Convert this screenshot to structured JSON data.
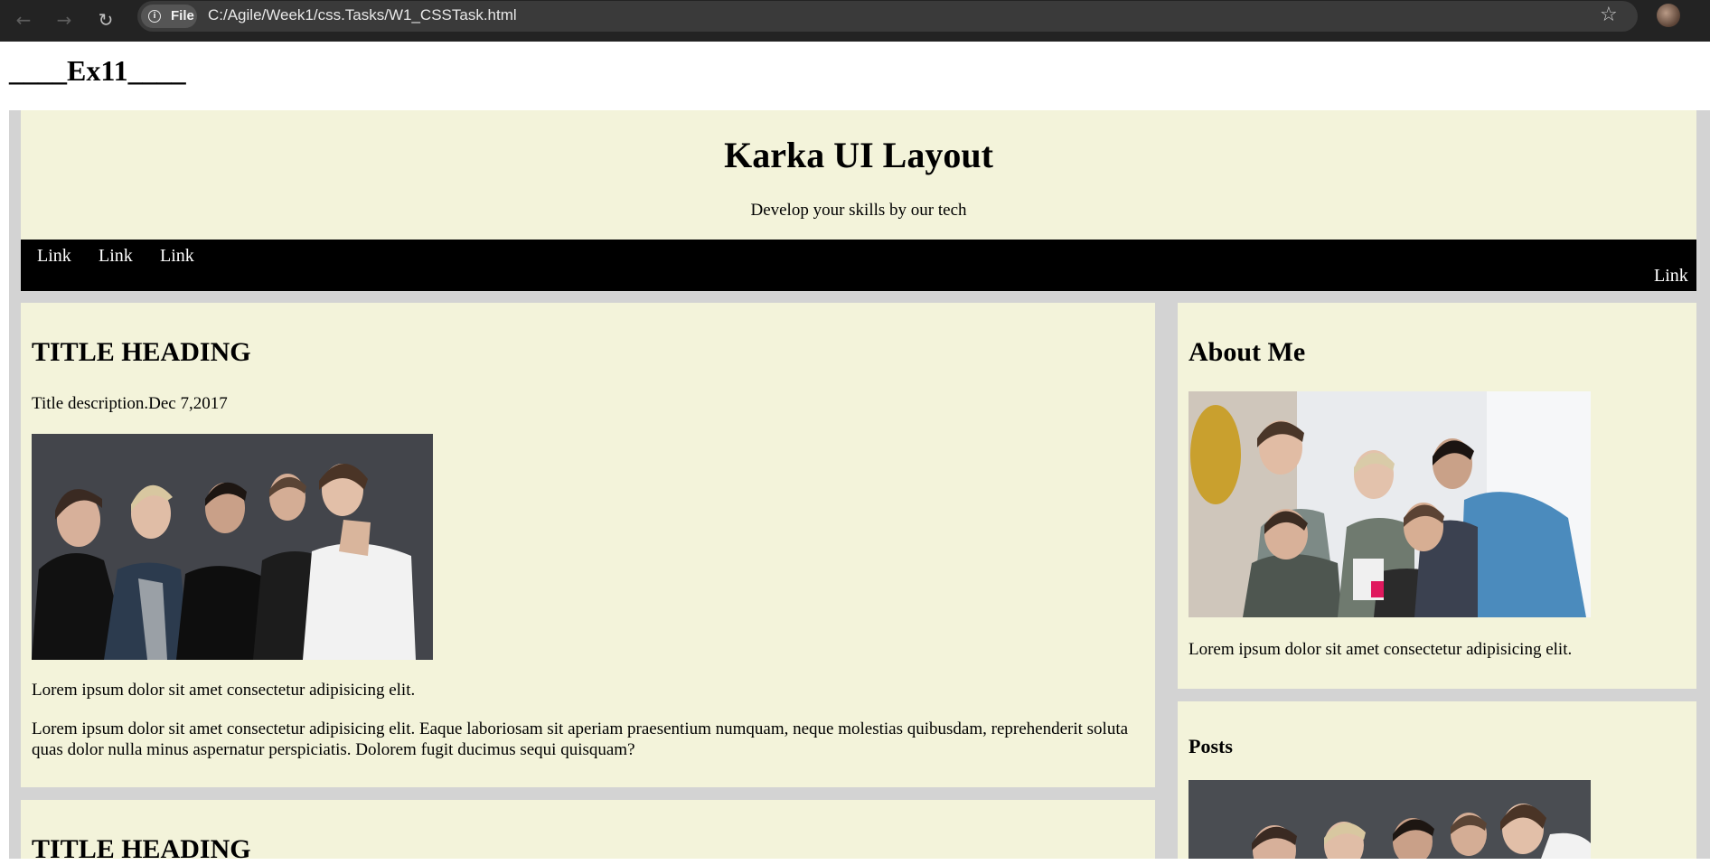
{
  "browser": {
    "url": "C:/Agile/Week1/css.Tasks/W1_CSSTask.html",
    "chip_label": "File"
  },
  "page": {
    "ex_title": "____Ex11____"
  },
  "header": {
    "title": "Karka UI Layout",
    "subtitle": "Develop your skills by our tech"
  },
  "nav": {
    "links": [
      "Link",
      "Link",
      "Link"
    ],
    "right_link": "Link"
  },
  "main": {
    "cards": [
      {
        "heading": "TITLE HEADING",
        "description": "Title description.Dec 7,2017",
        "para1": "Lorem ipsum dolor sit amet consectetur adipisicing elit.",
        "para2": "Lorem ipsum dolor sit amet consectetur adipisicing elit. Eaque laboriosam sit aperiam praesentium numquam, neque molestias quibusdam, reprehenderit soluta quas dolor nulla minus aspernatur perspiciatis. Dolorem fugit ducimus sequi quisquam?"
      },
      {
        "heading": "TITLE HEADING"
      }
    ]
  },
  "sidebar": {
    "about_heading": "About Me",
    "about_text": "Lorem ipsum dolor sit amet consectetur adipisicing elit.",
    "posts_heading": "Posts"
  },
  "colors": {
    "card_bg": "#f3f3da",
    "page_bg": "#d3d3d3",
    "nav_bg": "#000000"
  }
}
